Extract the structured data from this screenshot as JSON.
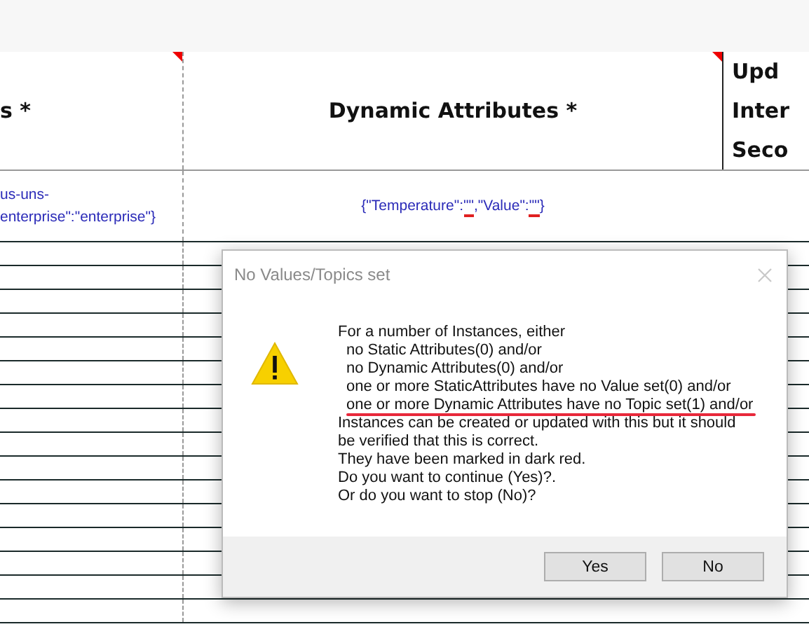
{
  "table": {
    "columns": [
      {
        "lines": [
          "s *"
        ],
        "flagged": true
      },
      {
        "lines": [
          "Dynamic Attributes *"
        ],
        "flagged": true
      },
      {
        "lines": [
          "Upd",
          "Inter",
          "Seco"
        ],
        "flagged": false
      }
    ],
    "rows": [
      {
        "cells": [
          {
            "segments": [
              {
                "text": "us-uns-",
                "error": false
              },
              {
                "text": "enterprise\":\"enterprise\"}",
                "error": false
              }
            ]
          },
          {
            "segments": [
              {
                "text": "{\"Temperature\":",
                "error": false
              },
              {
                "text": "\"\"",
                "error": true
              },
              {
                "text": ",\"Value\":",
                "error": false
              },
              {
                "text": "\"\"",
                "error": true
              },
              {
                "text": "}",
                "error": false
              }
            ]
          }
        ]
      }
    ]
  },
  "dialog": {
    "title": "No Values/Topics set",
    "message": [
      {
        "text": "For a number of Instances, either",
        "indented": false,
        "underlined": false
      },
      {
        "text": "no Static Attributes(0) and/or",
        "indented": true,
        "underlined": false
      },
      {
        "text": "no Dynamic Attributes(0) and/or",
        "indented": true,
        "underlined": false
      },
      {
        "text": "one or more StaticAttributes have no Value set(0) and/or",
        "indented": true,
        "underlined": false
      },
      {
        "text": "one or more Dynamic Attributes have no Topic set(1) and/or",
        "indented": true,
        "underlined": true
      },
      {
        "text": "Instances can be created or updated with this but it should",
        "indented": false,
        "underlined": false
      },
      {
        "text": "be verified that this is correct.",
        "indented": false,
        "underlined": false
      },
      {
        "text": "They have been marked in dark red.",
        "indented": false,
        "underlined": false
      },
      {
        "text": "Do you want to continue (Yes)?.",
        "indented": false,
        "underlined": false
      },
      {
        "text": "Or do you want to stop (No)?",
        "indented": false,
        "underlined": false
      }
    ],
    "buttons": [
      "Yes",
      "No"
    ]
  }
}
